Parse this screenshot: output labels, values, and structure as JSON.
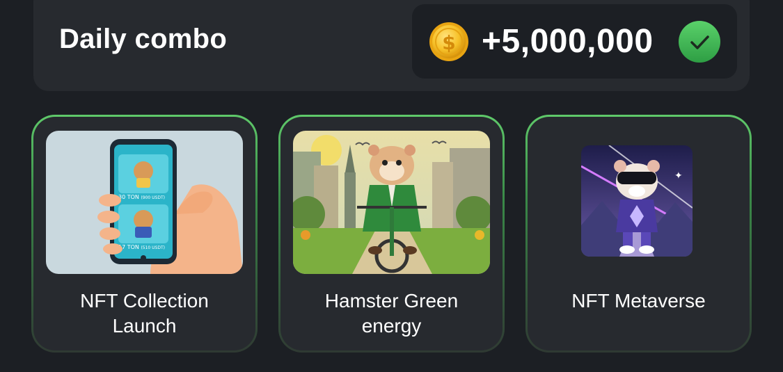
{
  "header": {
    "title": "Daily combo",
    "reward_amount": "+5,000,000",
    "coin_icon": "dollar-coin-icon",
    "status_icon": "checkmark-icon"
  },
  "cards": [
    {
      "label": "NFT Collection Launch",
      "image": "phone-nft-collection-illustration"
    },
    {
      "label": "Hamster Green energy",
      "image": "hamster-riding-bicycle-illustration"
    },
    {
      "label": "NFT Metaverse",
      "image": "hamster-vr-headset-illustration"
    }
  ],
  "card1_phone": {
    "price_1": "30",
    "unit_1": "TON",
    "usd_1": "(900 USDT)",
    "price_2": "17",
    "unit_2": "TON",
    "usd_2": "(510 USDT)"
  },
  "colors": {
    "background": "#1c1f24",
    "panel": "#272a2f",
    "accent_green": "#5fc96a",
    "coin_gold": "#f5b918"
  }
}
